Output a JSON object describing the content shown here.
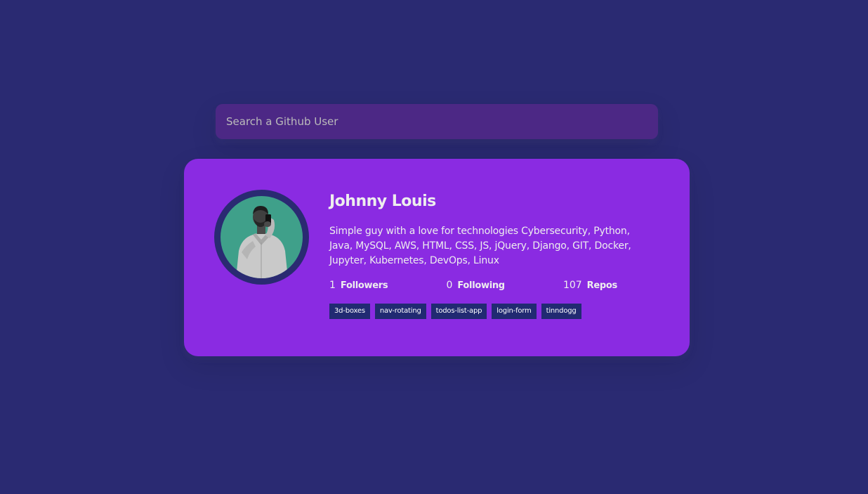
{
  "search": {
    "placeholder": "Search a Github User",
    "value": ""
  },
  "profile": {
    "name": "Johnny Louis",
    "bio": [
      "Simple guy with a love for technologies Cybersecurity, Python,",
      "Java, MySQL, AWS, HTML, CSS, JS, jQuery, Django, GIT, Docker,",
      "Jupyter, Kubernetes, DevOps, Linux"
    ],
    "stats": {
      "followers": {
        "value": "1",
        "label": "Followers"
      },
      "following": {
        "value": "0",
        "label": "Following"
      },
      "repos": {
        "value": "107",
        "label": "Repos"
      }
    },
    "repos": [
      "3d-boxes",
      "nav-rotating",
      "todos-list-app",
      "login-form",
      "tinndogg"
    ]
  },
  "colors": {
    "background": "#2a2a72",
    "card": "#8a2be2",
    "search_bg": "#4c2885",
    "repo_bg": "#212a72",
    "avatar_bg": "#3fa08a"
  }
}
